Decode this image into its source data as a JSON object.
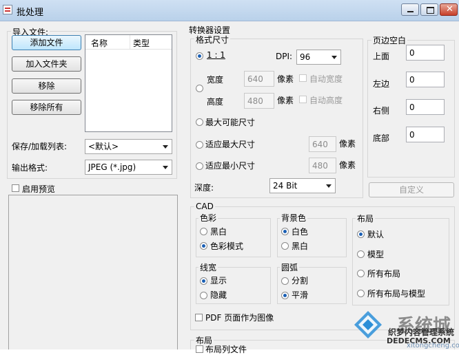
{
  "window": {
    "title": "批处理"
  },
  "import": {
    "group_label": "导入文件:",
    "add_file": "添加文件",
    "add_folder": "加入文件夹",
    "remove": "移除",
    "remove_all": "移除所有",
    "list_headers": [
      "名称",
      "类型"
    ]
  },
  "save_list": {
    "label": "保存/加载列表:",
    "value": "<默认>"
  },
  "output_format": {
    "label": "输出格式:",
    "value": "JPEG (*.jpg)"
  },
  "preview": {
    "label": "启用预览"
  },
  "converter": {
    "group_label": "转换器设置",
    "format_size": {
      "label": "格式尺寸",
      "one_to_one": "1 : 1",
      "dpi_label": "DPI:",
      "dpi_value": "96",
      "width_label": "宽度",
      "width_value": "640",
      "height_label": "高度",
      "height_value": "480",
      "unit": "像素",
      "auto_width": "自动宽度",
      "auto_height": "自动高度",
      "max_possible": "最大可能尺寸",
      "fit_max": "适应最大尺寸",
      "fit_max_value": "640",
      "fit_min": "适应最小尺寸",
      "fit_min_value": "480",
      "depth_label": "深度:",
      "depth_value": "24 Bit"
    }
  },
  "margins": {
    "group_label": "页边空白",
    "top_label": "上面",
    "top_value": "0",
    "left_label": "左边",
    "left_value": "0",
    "right_label": "右侧",
    "right_value": "0",
    "bottom_label": "底部",
    "bottom_value": "0",
    "custom_button": "自定义"
  },
  "cad": {
    "group_label": "CAD",
    "color": {
      "label": "色彩",
      "bw": "黑白",
      "color_mode": "色彩模式"
    },
    "background": {
      "label": "背景色",
      "white": "白色",
      "black": "黑白"
    },
    "layout": {
      "label": "布局",
      "default": "默认",
      "model": "模型",
      "all_layouts": "所有布局",
      "all_layouts_model": "所有布局与模型"
    },
    "line_width": {
      "label": "线宽",
      "show": "显示",
      "hide": "隐藏"
    },
    "arc": {
      "label": "圆弧",
      "split": "分割",
      "smooth": "平滑"
    },
    "pdf_as_image": "PDF 页面作为图像"
  },
  "bottom_layout": {
    "label": "布局",
    "list_files": "布局列文件"
  },
  "watermark": {
    "brand": "系统城",
    "line1": "织梦内容管理系统",
    "line2": "DEDECMS.COM",
    "line3": "xitongcheng.com"
  },
  "colors": {
    "accent": "#1a5fb4",
    "titlebar": "#c3d7ee",
    "client_bg": "#f0f0f0"
  }
}
